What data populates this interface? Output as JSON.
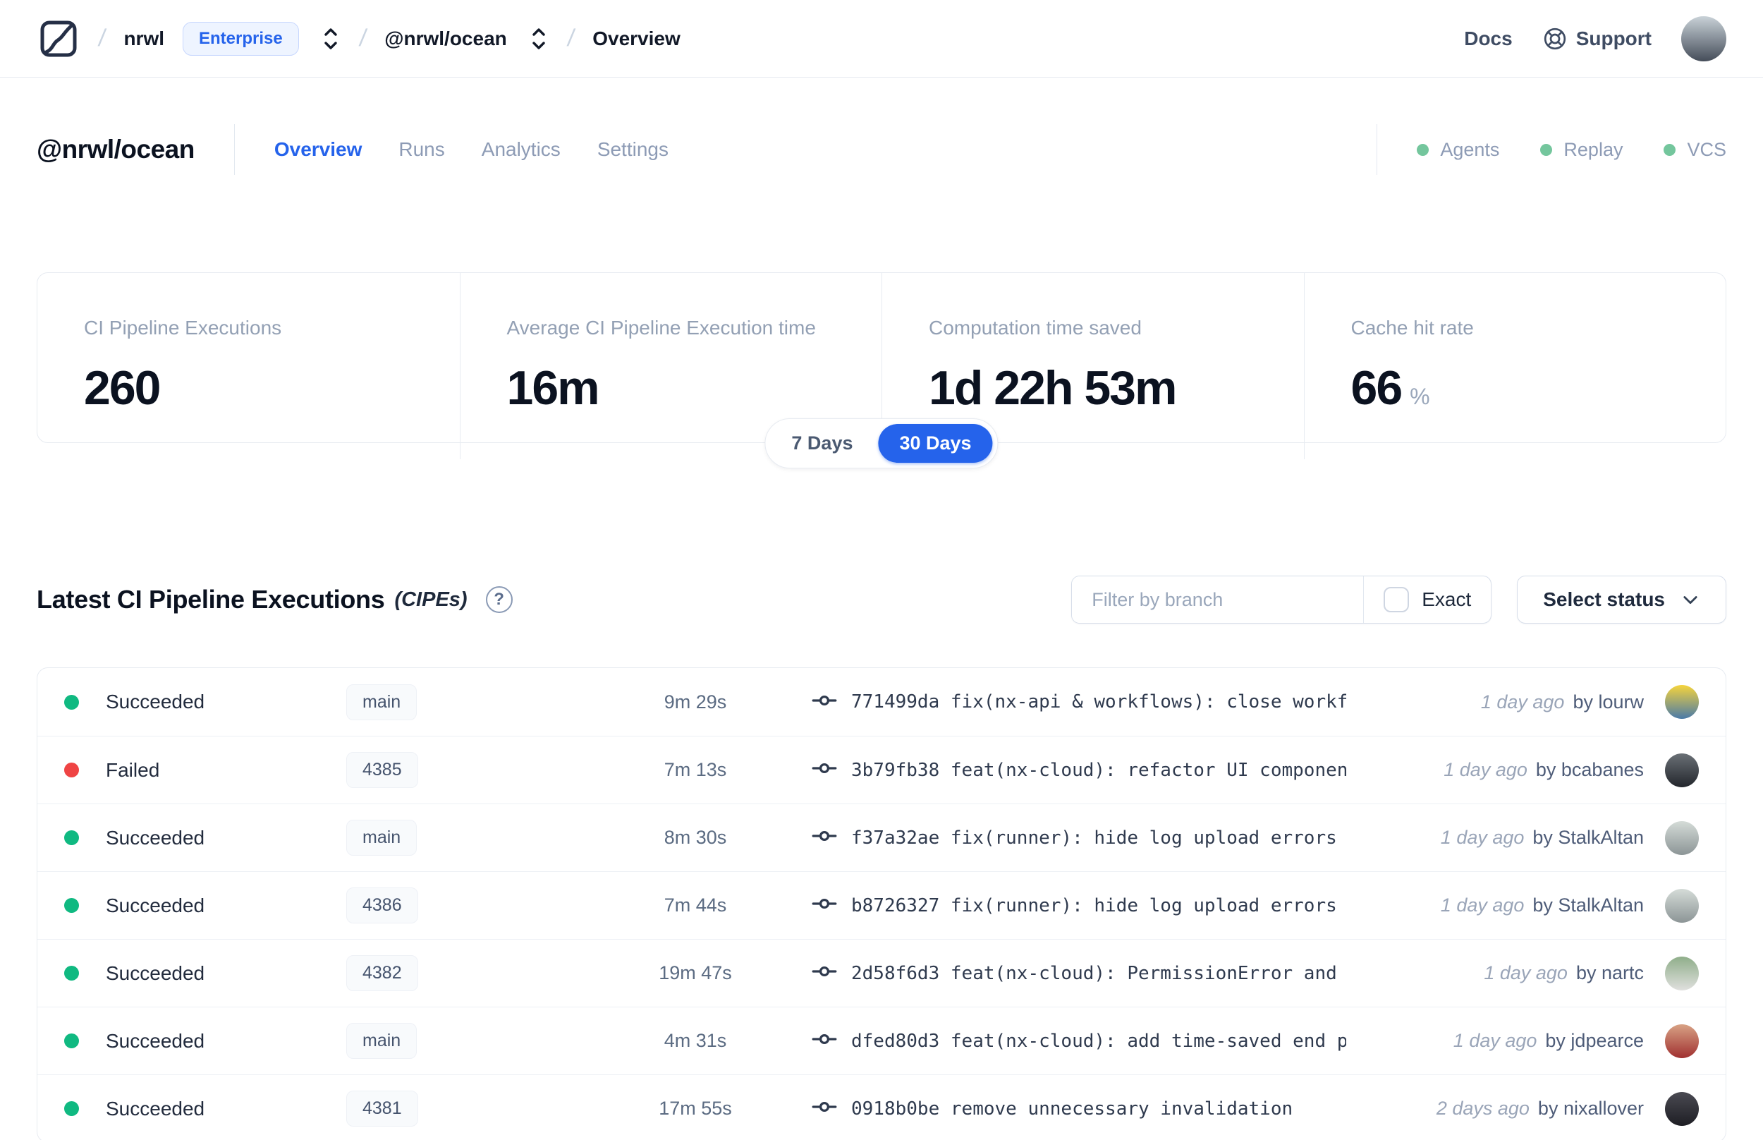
{
  "colors": {
    "accent": "#2563eb",
    "success": "#10b981",
    "failed": "#ef4444",
    "feature_dot": "#74c69d"
  },
  "header": {
    "separator": "/",
    "org": "nrwl",
    "org_badge": "Enterprise",
    "workspace": "@nrwl/ocean",
    "page": "Overview",
    "docs_label": "Docs",
    "support_label": "Support",
    "avatar_colors": [
      "#c9d2d8",
      "#454d59"
    ]
  },
  "workspace": {
    "title": "@nrwl/ocean",
    "tabs": [
      {
        "label": "Overview",
        "active": true
      },
      {
        "label": "Runs",
        "active": false
      },
      {
        "label": "Analytics",
        "active": false
      },
      {
        "label": "Settings",
        "active": false
      }
    ],
    "features": [
      {
        "label": "Agents"
      },
      {
        "label": "Replay"
      },
      {
        "label": "VCS"
      }
    ]
  },
  "stats": {
    "cards": [
      {
        "label": "CI Pipeline Executions",
        "value": "260",
        "suffix": ""
      },
      {
        "label": "Average CI Pipeline Execution time",
        "value": "16m",
        "suffix": ""
      },
      {
        "label": "Computation time saved",
        "value": "1d 22h 53m",
        "suffix": ""
      },
      {
        "label": "Cache hit rate",
        "value": "66",
        "suffix": "%"
      }
    ]
  },
  "range_toggle": {
    "options": [
      "7 Days",
      "30 Days"
    ],
    "selected": "30 Days"
  },
  "cipes": {
    "title": "Latest CI Pipeline Executions",
    "subtitle": "(CIPEs)",
    "help": "?",
    "filter_placeholder": "Filter by branch",
    "exact_label": "Exact",
    "select_status_label": "Select status",
    "rows": [
      {
        "status": "Succeeded",
        "status_key": "success",
        "branch": "main",
        "duration": "9m 29s",
        "commit_hash": "771499da",
        "commit_message": "fix(nx-api & workflows): close workfl…",
        "time_ago": "1 day ago",
        "author": "by lourw",
        "avatar_colors": [
          "#f6d43c",
          "#4a7aa8"
        ]
      },
      {
        "status": "Failed",
        "status_key": "failed",
        "branch": "4385",
        "duration": "7m 13s",
        "commit_hash": "3b79fb38",
        "commit_message": "feat(nx-cloud): refactor UI component…",
        "time_ago": "1 day ago",
        "author": "by bcabanes",
        "avatar_colors": [
          "#6a7076",
          "#23262c"
        ]
      },
      {
        "status": "Succeeded",
        "status_key": "success",
        "branch": "main",
        "duration": "8m 30s",
        "commit_hash": "f37a32ae",
        "commit_message": "fix(runner): hide log upload errors b…",
        "time_ago": "1 day ago",
        "author": "by StalkAltan",
        "avatar_colors": [
          "#d5dcd8",
          "#8c9596"
        ]
      },
      {
        "status": "Succeeded",
        "status_key": "success",
        "branch": "4386",
        "duration": "7m 44s",
        "commit_hash": "b8726327",
        "commit_message": "fix(runner): hide log upload errors b…",
        "time_ago": "1 day ago",
        "author": "by StalkAltan",
        "avatar_colors": [
          "#d5dcd8",
          "#8c9596"
        ]
      },
      {
        "status": "Succeeded",
        "status_key": "success",
        "branch": "4382",
        "duration": "19m 47s",
        "commit_hash": "2d58f6d3",
        "commit_message": "feat(nx-cloud): PermissionError and N…",
        "time_ago": "1 day ago",
        "author": "by nartc",
        "avatar_colors": [
          "#8fae8a",
          "#e0e0de"
        ]
      },
      {
        "status": "Succeeded",
        "status_key": "success",
        "branch": "main",
        "duration": "4m 31s",
        "commit_hash": "dfed80d3",
        "commit_message": "feat(nx-cloud): add time-saved end po…",
        "time_ago": "1 day ago",
        "author": "by jdpearce",
        "avatar_colors": [
          "#d8a285",
          "#a03030"
        ]
      },
      {
        "status": "Succeeded",
        "status_key": "success",
        "branch": "4381",
        "duration": "17m 55s",
        "commit_hash": "0918b0be",
        "commit_message": "remove unnecessary invalidation",
        "time_ago": "2 days ago",
        "author": "by nixallover",
        "avatar_colors": [
          "#4a4a52",
          "#1e1e24"
        ]
      }
    ]
  }
}
